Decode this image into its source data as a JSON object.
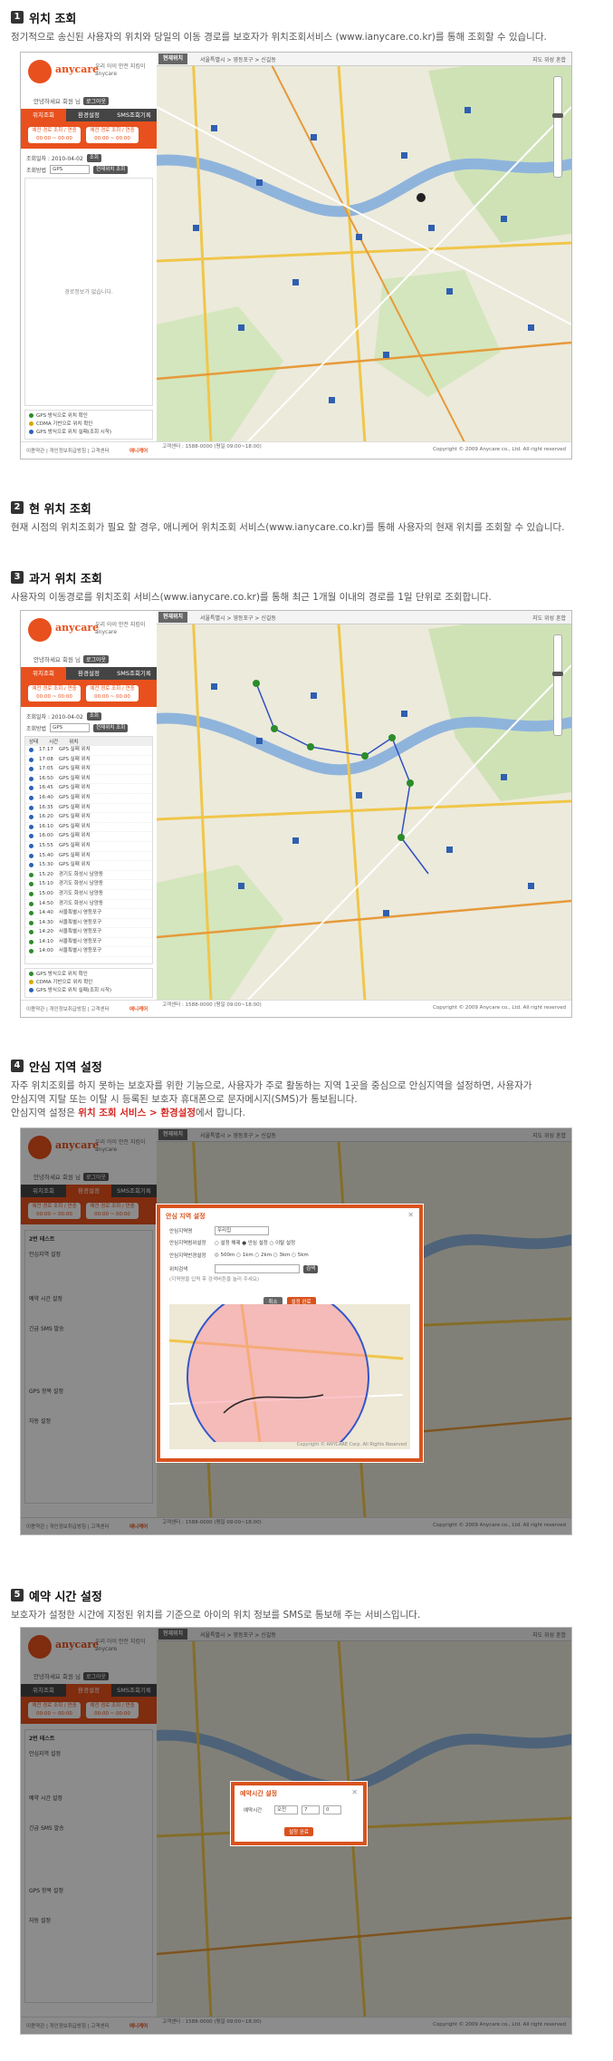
{
  "sections": [
    {
      "num": "1",
      "title": "위치 조회",
      "desc": "정기적으로 송신된 사용자의 위치와 당일의 이동 경로를 보호자가 위치조회서비스 (www.ianycare.co.kr)를 통해 조회할 수 있습니다."
    },
    {
      "num": "2",
      "title": "현 위치 조회",
      "desc": "현재 시점의 위치조회가 필요 할 경우, 애니케어 위치조회 서비스(www.ianycare.co.kr)를 통해 사용자의 현재 위치를 조회할 수 있습니다."
    },
    {
      "num": "3",
      "title": "과거 위치 조회",
      "desc": "사용자의 이동경로를 위치조회 서비스(www.ianycare.co.kr)를 통해 최근 1개월 이내의 경로를 1일 단위로 조회합니다."
    },
    {
      "num": "4",
      "title": "안심 지역 설정",
      "desc1": "자주 위치조회를 하지 못하는 보호자를 위한 기능으로, 사용자가 주로 활동하는 지역 1곳을 중심으로 안심지역을 설정하면, 사용자가",
      "desc2": "안심지역 지탈 또는 이탈 시 등록된 보호자 휴대폰으로 문자메시지(SMS)가 통보됩니다.",
      "desc3_pre": "안심지역 설정은 ",
      "desc3_hl": "위치 조회 서비스 > 환경설정",
      "desc3_post": "에서 합니다."
    },
    {
      "num": "5",
      "title": "예약 시간 설정",
      "desc": "보호자가 설정한 시간에 지정된 위치를 기준으로 아이의 위치 정보를 SMS로 통보해 주는 서비스입니다."
    }
  ],
  "app": {
    "brand": "anycare",
    "tagline": "우리 아이 안전 지킴이 anycare",
    "user": "안녕하세요 회원 님",
    "logout": "로그아웃",
    "tabs": [
      "위치조회",
      "환경설정",
      "SMS조회기록"
    ],
    "pill_left": "예전 경로 조회 / 연중 00:00 ~ 00:00",
    "pill_right": "예전 경로 조회 / 연중 00:00 ~ 00:00",
    "date_label": "조회일자 : 2010-04-02",
    "search_btn": "조회",
    "gps_label": "조회방법",
    "gps_value": "GPS",
    "req_btn": "현재위치 조회",
    "empty": "경로정보가 없습니다.",
    "legend": [
      "GPS 방식으로 위치 확인",
      "CDMA 기반으로 위치 확인",
      "GPS 방식으로 위치 실패(조회 시작)"
    ],
    "footer_links": "이용약관 | 개인정보취급방침 | 고객센터",
    "footer_brand": "애니케어",
    "footer_contact": "고객센터 : 1588-0000 (평일 09:00~18:00)",
    "footer_copy": "Copyright © 2009 Anycare co., Ltd. All right reserved",
    "map_current": "현재위치",
    "map_crumbs": "서울특별시  >  영등포구  >  신길동",
    "map_opts": "지도  위성  혼합",
    "history_head": [
      "상태",
      "시간",
      "위치"
    ],
    "history_rows": [
      {
        "t": "17:17",
        "loc": "GPS 실패 위치"
      },
      {
        "t": "17:08",
        "loc": "GPS 실패 위치"
      },
      {
        "t": "17:05",
        "loc": "GPS 실패 위치"
      },
      {
        "t": "16:50",
        "loc": "GPS 실패 위치"
      },
      {
        "t": "16:45",
        "loc": "GPS 실패 위치"
      },
      {
        "t": "16:40",
        "loc": "GPS 실패 위치"
      },
      {
        "t": "16:35",
        "loc": "GPS 실패 위치"
      },
      {
        "t": "16:20",
        "loc": "GPS 실패 위치"
      },
      {
        "t": "16:10",
        "loc": "GPS 실패 위치"
      },
      {
        "t": "16:00",
        "loc": "GPS 실패 위치"
      },
      {
        "t": "15:55",
        "loc": "GPS 실패 위치"
      },
      {
        "t": "15:40",
        "loc": "GPS 실패 위치"
      },
      {
        "t": "15:30",
        "loc": "GPS 실패 위치"
      },
      {
        "t": "15:20",
        "loc": "경기도 화성시 남양동"
      },
      {
        "t": "15:10",
        "loc": "경기도 화성시 남양동"
      },
      {
        "t": "15:00",
        "loc": "경기도 화성시 남양동"
      },
      {
        "t": "14:50",
        "loc": "경기도 화성시 남양동"
      },
      {
        "t": "14:40",
        "loc": "서울특별시 영등포구"
      },
      {
        "t": "14:30",
        "loc": "서울특별시 영등포구"
      },
      {
        "t": "14:20",
        "loc": "서울특별시 영등포구"
      },
      {
        "t": "14:10",
        "loc": "서울특별시 영등포구"
      },
      {
        "t": "14:00",
        "loc": "서울특별시 영등포구"
      }
    ],
    "safe_modal": {
      "title": "안심 지역 설정",
      "r1_label": "안심지역명",
      "r1_value": "우리집",
      "r2_label": "안심지역범위설정",
      "r2_opts": "○ 설정 해제   ● 안심 설정   ○ 이탈 설정",
      "r3_label": "안심지역반경설정",
      "r3_opts": "◎ 500m  ○ 1km  ○ 2km  ○ 3km  ○ 5km",
      "r4_label": "위치검색",
      "search_btn": "검색",
      "hint": "(지역명을 입력 후 검색버튼을 눌러 주세요)",
      "cancel": "취소",
      "ok": "설정 완료",
      "map_copy": "Copyright © ANYCARE Corp. All Rights Reserved"
    },
    "reserve_modal": {
      "title": "예약시간 설정",
      "label": "예약시간",
      "hour": "오전",
      "h": "7",
      "m": "0",
      "ok": "설정 완료"
    },
    "setting_panel": {
      "name": "2번 테스트",
      "item1": "안심지역 설정",
      "item2": "예약 시간 설정",
      "item3": "긴급 SMS 발송",
      "item4": "GPS 항목 설정",
      "item5": "자동 설정",
      "edit": "설정변경"
    }
  }
}
